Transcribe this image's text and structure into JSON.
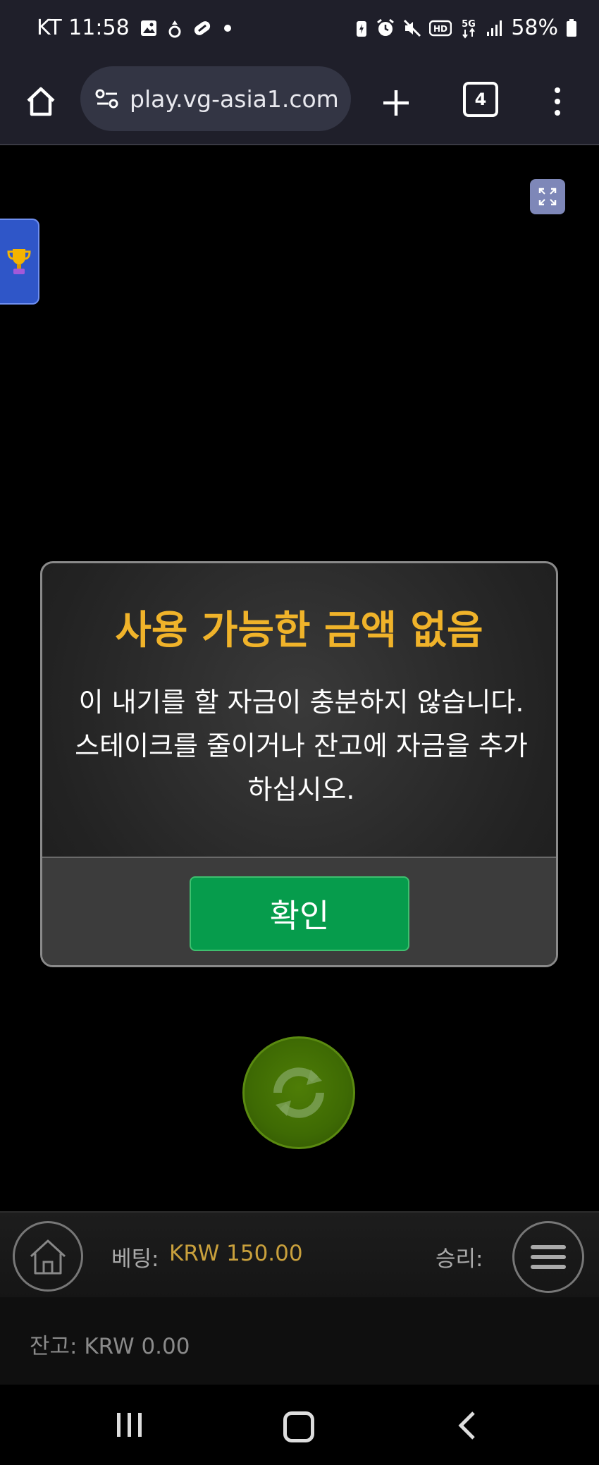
{
  "status_bar": {
    "carrier_time": "KT 11:58",
    "battery": "58%",
    "icons_left": [
      "image-icon",
      "notification-icon",
      "link-icon",
      "dot-icon"
    ],
    "icons_right": [
      "battery-saver-icon",
      "alarm-icon",
      "mute-icon",
      "hd-icon",
      "5g-icon",
      "signal-icon",
      "battery-icon"
    ]
  },
  "browser": {
    "url": "play.vg-asia1.com",
    "tab_count": "4"
  },
  "dialog": {
    "title": "사용 가능한 금액 없음",
    "message": "이 내기를 할 자금이 충분하지 않습니다. 스테이크를 줄이거나 잔고에 자금을 추가하십시오.",
    "confirm_label": "확인"
  },
  "game_bar": {
    "bet_label": "베팅:",
    "bet_value": "KRW 150.00",
    "win_label": "승리:",
    "balance_text": "잔고: KRW 0.00"
  },
  "colors": {
    "title": "#f0b32a",
    "confirm": "#069c4c",
    "bet_value": "#c9a03c",
    "spin": "#4e7d06"
  }
}
